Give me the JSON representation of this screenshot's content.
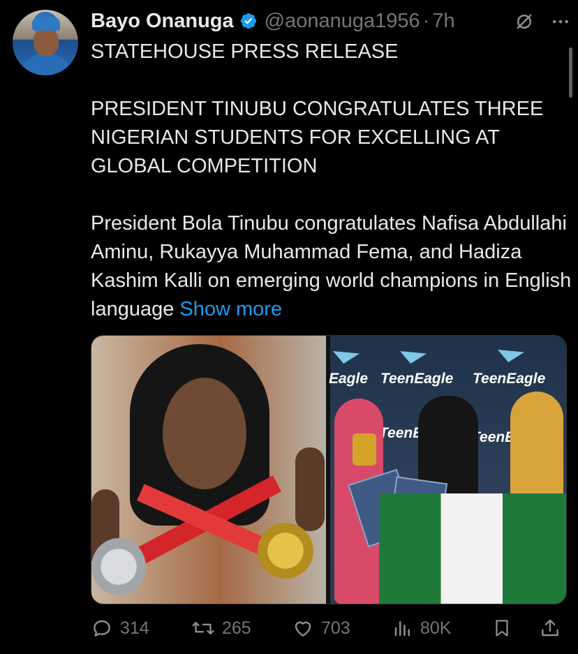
{
  "author": {
    "name": "Bayo Onanuga",
    "handle": "@aonanuga1956",
    "separator": "·",
    "time": "7h",
    "verified": true
  },
  "tweet": {
    "line1": "STATEHOUSE PRESS RELEASE",
    "headline": "PRESIDENT TINUBU CONGRATULATES THREE NIGERIAN STUDENTS FOR EXCELLING AT GLOBAL COMPETITION",
    "body": "President Bola Tinubu congratulates Nafisa Abdullahi Aminu, Rukayya Muhammad Fema, and Hadiza Kashim Kalli on emerging world champions in English language",
    "show_more": "Show more"
  },
  "media": {
    "banner_labels": [
      "Eagle",
      "TeenEagle",
      "TeenEagle",
      "TeenEa",
      "TeenEa"
    ]
  },
  "metrics": {
    "replies": "314",
    "reposts": "265",
    "likes": "703",
    "views": "80K"
  },
  "icons": {
    "header": [
      "grok-icon",
      "more-icon"
    ],
    "actions": [
      "reply-icon",
      "repost-icon",
      "like-icon",
      "views-icon",
      "bookmark-icon",
      "share-icon"
    ]
  },
  "colors": {
    "background": "#000000",
    "text": "#e7e9ea",
    "muted": "#71767b",
    "link": "#1d9bf0"
  }
}
